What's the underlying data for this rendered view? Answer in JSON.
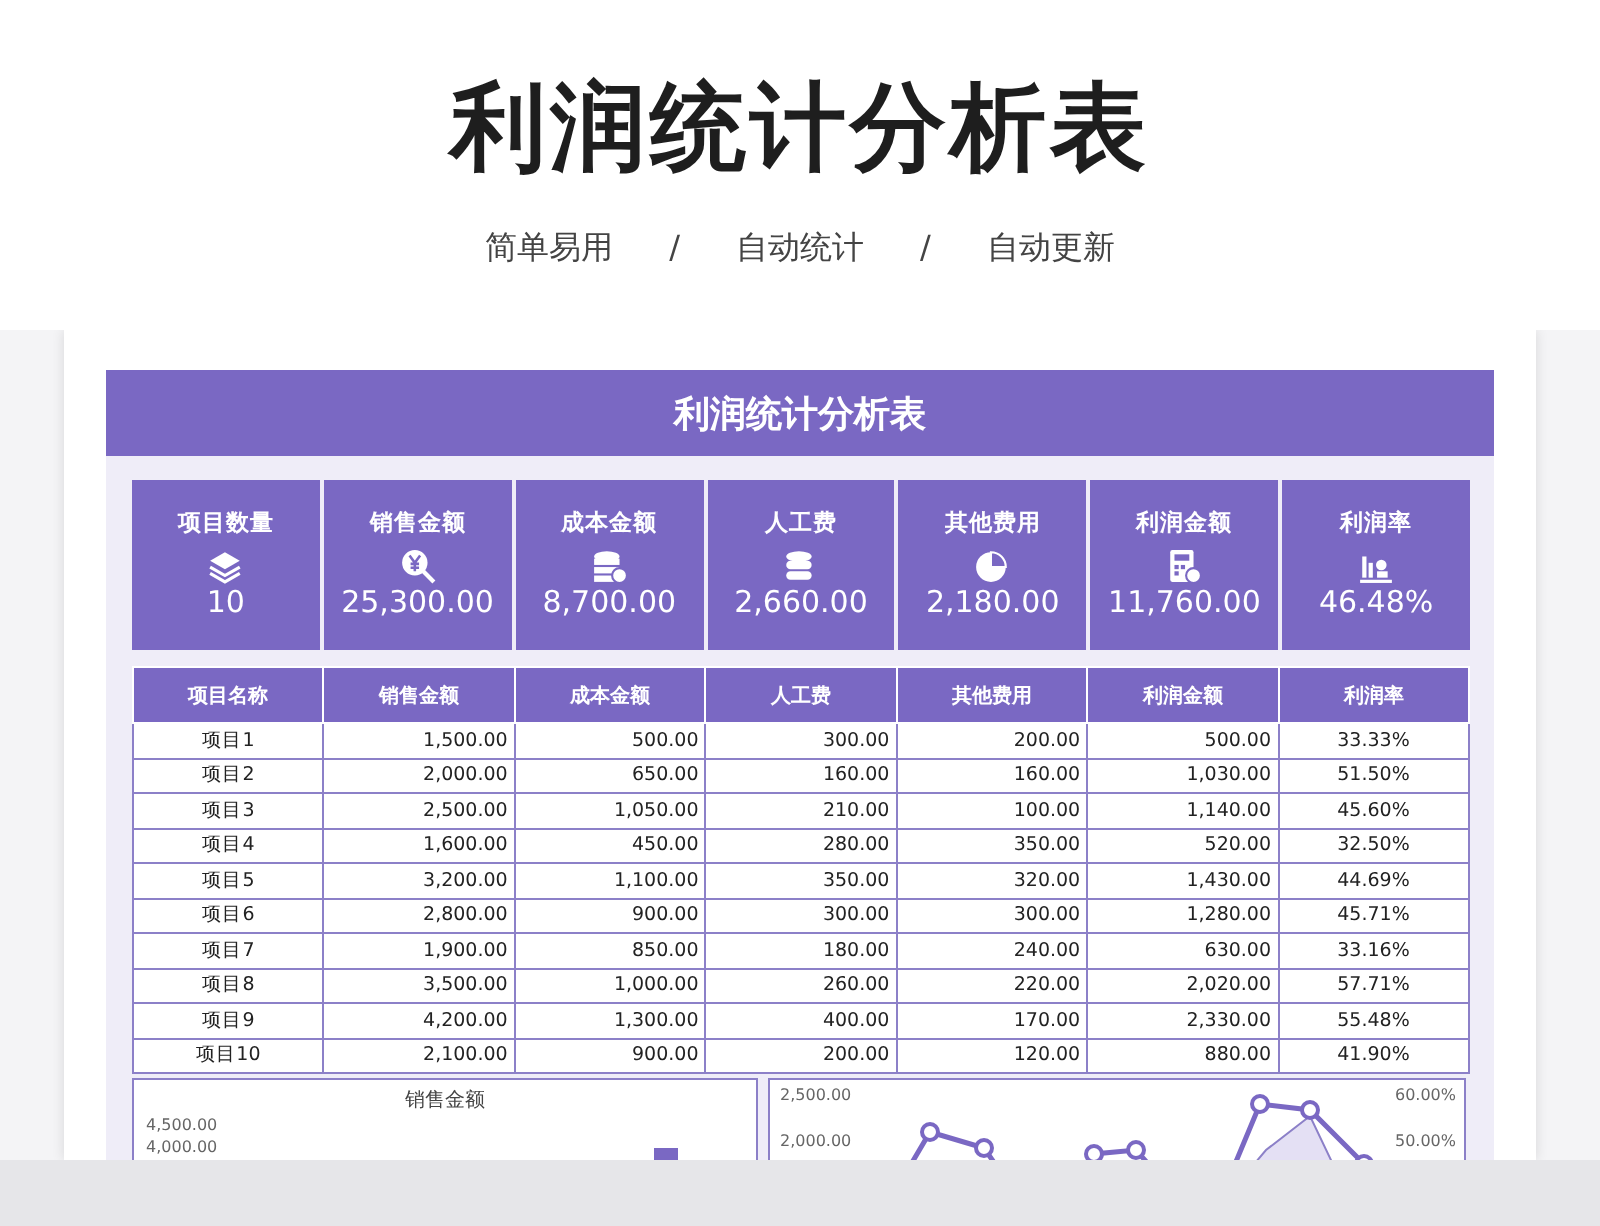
{
  "header": {
    "title": "利润统计分析表",
    "taglines": [
      "简单易用",
      "自动统计",
      "自动更新"
    ],
    "separator": "/"
  },
  "sheet": {
    "title": "利润统计分析表",
    "summary": [
      {
        "label": "项目数量",
        "value": "10"
      },
      {
        "label": "销售金额",
        "value": "25,300.00"
      },
      {
        "label": "成本金额",
        "value": "8,700.00"
      },
      {
        "label": "人工费",
        "value": "2,660.00"
      },
      {
        "label": "其他费用",
        "value": "2,180.00"
      },
      {
        "label": "利润金额",
        "value": "11,760.00"
      },
      {
        "label": "利润率",
        "value": "46.48%"
      }
    ],
    "table": {
      "columns": [
        "项目名称",
        "销售金额",
        "成本金额",
        "人工费",
        "其他费用",
        "利润金额",
        "利润率"
      ],
      "rows": [
        [
          "项目1",
          "1,500.00",
          "500.00",
          "300.00",
          "200.00",
          "500.00",
          "33.33%"
        ],
        [
          "项目2",
          "2,000.00",
          "650.00",
          "160.00",
          "160.00",
          "1,030.00",
          "51.50%"
        ],
        [
          "项目3",
          "2,500.00",
          "1,050.00",
          "210.00",
          "100.00",
          "1,140.00",
          "45.60%"
        ],
        [
          "项目4",
          "1,600.00",
          "450.00",
          "280.00",
          "350.00",
          "520.00",
          "32.50%"
        ],
        [
          "项目5",
          "3,200.00",
          "1,100.00",
          "350.00",
          "320.00",
          "1,430.00",
          "44.69%"
        ],
        [
          "项目6",
          "2,800.00",
          "900.00",
          "300.00",
          "300.00",
          "1,280.00",
          "45.71%"
        ],
        [
          "项目7",
          "1,900.00",
          "850.00",
          "180.00",
          "240.00",
          "630.00",
          "33.16%"
        ],
        [
          "项目8",
          "3,500.00",
          "1,000.00",
          "260.00",
          "220.00",
          "2,020.00",
          "57.71%"
        ],
        [
          "项目9",
          "4,200.00",
          "1,300.00",
          "400.00",
          "170.00",
          "2,330.00",
          "55.48%"
        ],
        [
          "项目10",
          "2,100.00",
          "900.00",
          "200.00",
          "120.00",
          "880.00",
          "41.90%"
        ]
      ]
    },
    "bar_chart": {
      "title": "销售金额",
      "tick_labels": [
        "4,500.00",
        "4,000.00"
      ]
    },
    "line_chart": {
      "left_tick_labels": [
        "2,500.00",
        "2,000.00"
      ],
      "right_tick_labels": [
        "60.00%",
        "50.00%"
      ]
    }
  }
}
